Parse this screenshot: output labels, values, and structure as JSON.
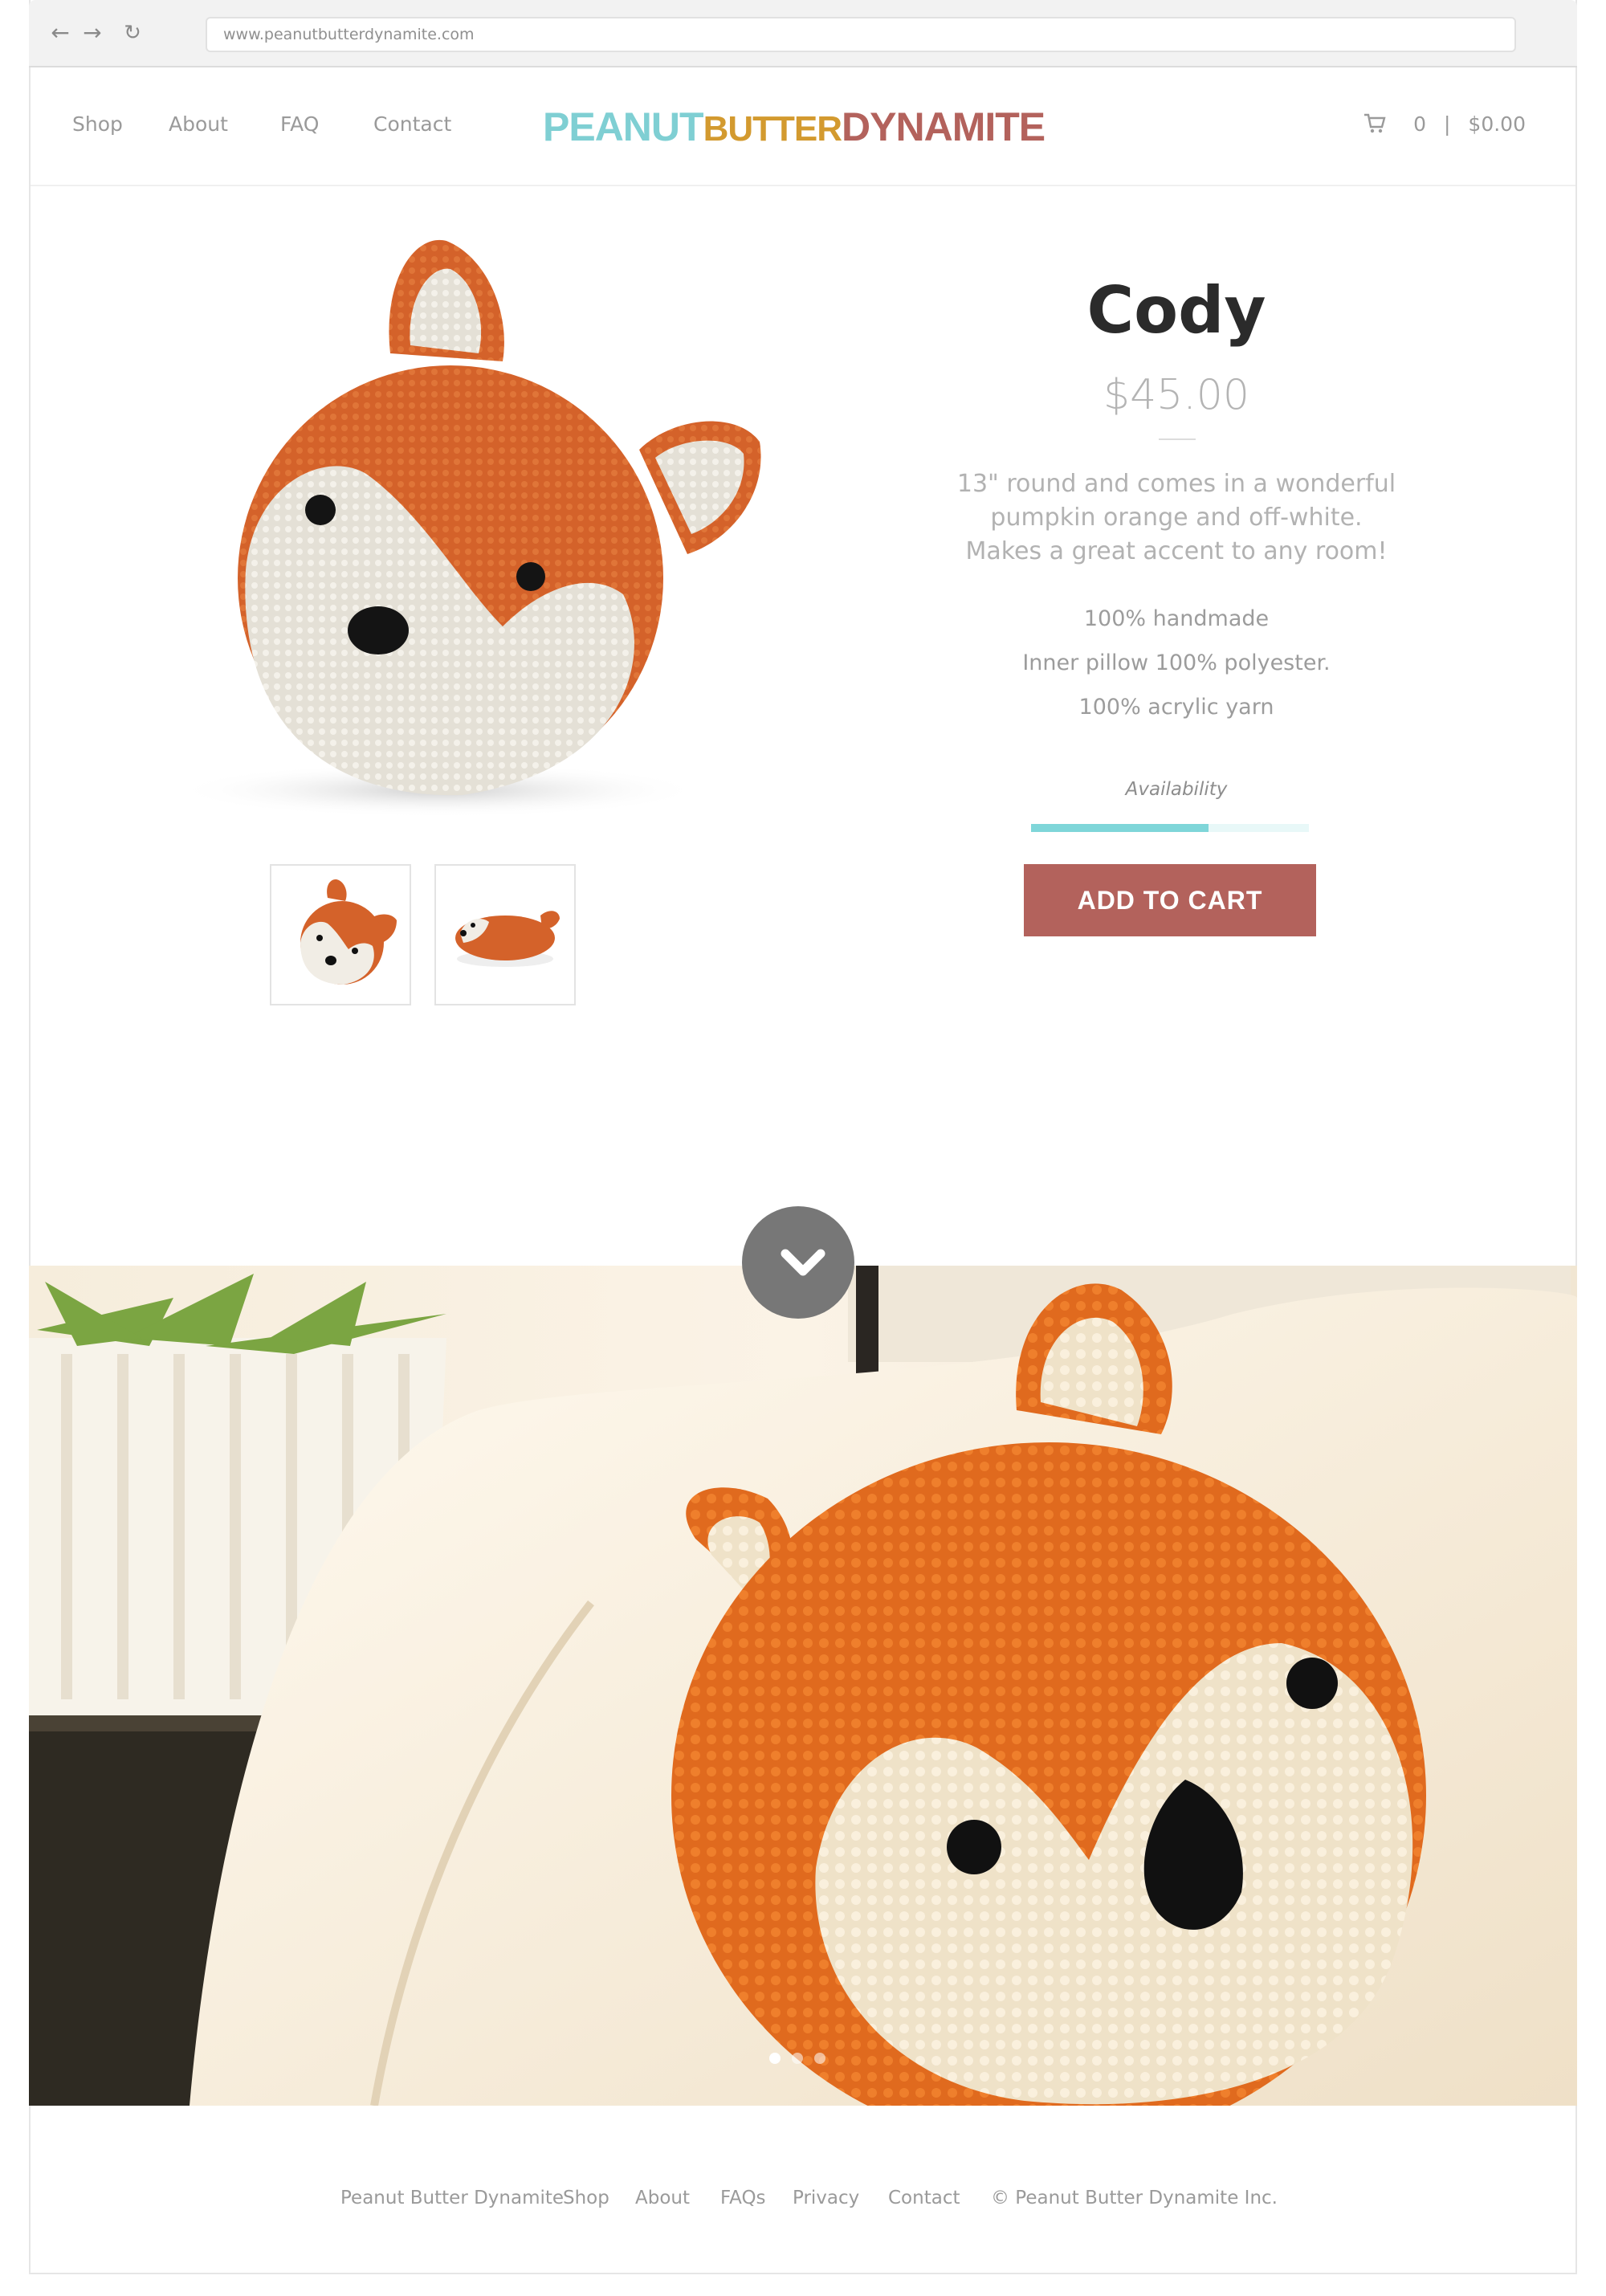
{
  "browser": {
    "url": "www.peanutbutterdynamite.com"
  },
  "header": {
    "nav": [
      "Shop",
      "About",
      "FAQ",
      "Contact"
    ],
    "logo": {
      "word1": "PEANUT",
      "word2": "BUTTER",
      "word3": "DYNAMITE"
    },
    "cart": {
      "count": "0",
      "separator": "|",
      "total": "$0.00"
    }
  },
  "product": {
    "title": "Cody",
    "price": "$45.00",
    "description": [
      "13\" round and comes in a wonderful",
      "pumpkin orange and off-white.",
      "Makes a great accent to any room!"
    ],
    "specs": [
      "100% handmade",
      "Inner pillow 100% polyester.",
      "100% acrylic yarn"
    ],
    "availability_label": "Availability",
    "availability_fraction": 0.64,
    "add_to_cart": "ADD TO CART"
  },
  "colors": {
    "button": "#b3625c",
    "availability_bar": "#7fd6d9",
    "logo_teal": "#7fcfd3",
    "logo_mustard": "#d39a2f",
    "logo_rust": "#b3625c"
  },
  "footer": {
    "links": [
      "Peanut Butter Dynamite",
      "Shop",
      "About",
      "FAQs",
      "Privacy",
      "Contact"
    ],
    "copyright": "© Peanut Butter Dynamite Inc."
  }
}
